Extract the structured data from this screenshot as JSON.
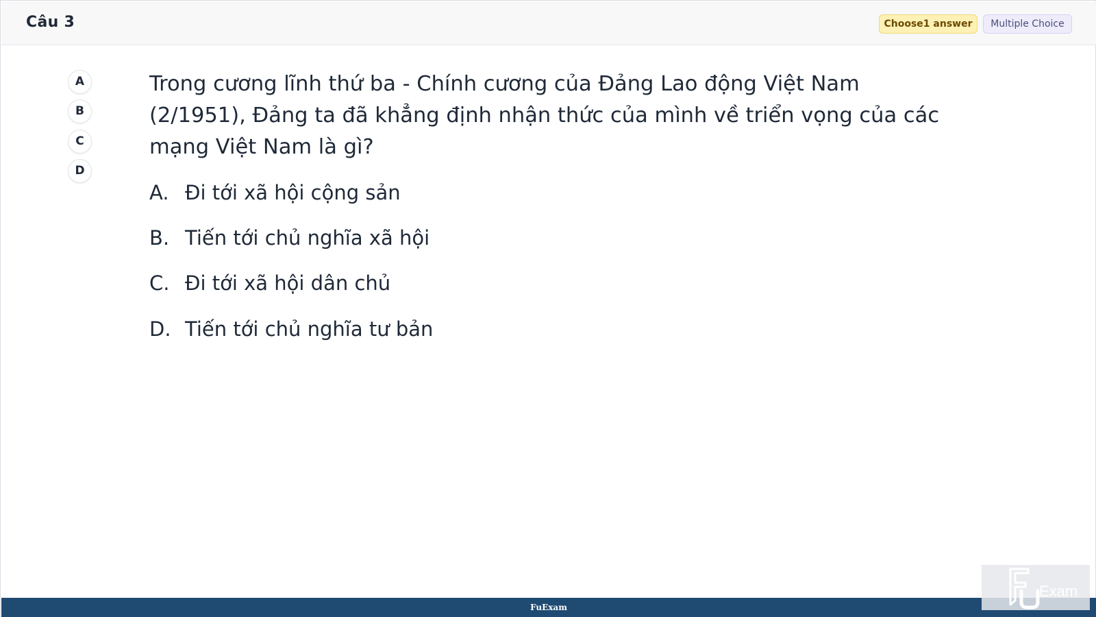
{
  "header": {
    "question_title": "Câu 3",
    "badge_choose": "Choose1 answer",
    "badge_type": "Multiple Choice"
  },
  "option_circles": [
    "A",
    "B",
    "C",
    "D"
  ],
  "question": {
    "text": "Trong cương lĩnh thứ ba - Chính cương của Đảng Lao động Việt Nam (2/1951), Đảng ta đã khẳng định nhận thức của mình về triển vọng của các mạng Việt Nam là gì?"
  },
  "answers": [
    {
      "letter": "A.",
      "text": "Đi tới xã hội cộng sản"
    },
    {
      "letter": "B.",
      "text": "Tiến tới chủ nghĩa xã hội"
    },
    {
      "letter": "C.",
      "text": "Đi tới xã hội dân chủ"
    },
    {
      "letter": "D.",
      "text": "Tiến tới chủ nghĩa tư bản"
    }
  ],
  "footer": {
    "brand": "FuExam"
  },
  "watermark": {
    "logo_text": "Exam",
    "icon": "fu-exam-logo-icon"
  },
  "colors": {
    "footer_bg": "#1f4a72",
    "badge_choose_bg": "#fdf1b5",
    "badge_type_bg": "#eeecfb"
  }
}
